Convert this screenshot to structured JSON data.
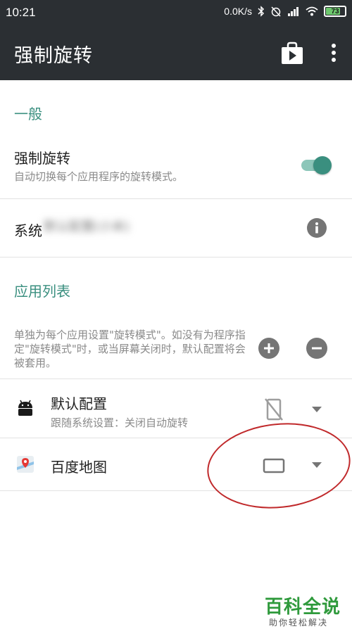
{
  "status_bar": {
    "time": "10:21",
    "network_speed": "0.0K/s",
    "battery": "73"
  },
  "app_bar": {
    "title": "强制旋转",
    "play_icon": "play-store-icon",
    "more_icon": "more-vert-icon"
  },
  "general": {
    "header": "一般",
    "force_rotate": {
      "title": "强制旋转",
      "subtitle": "自动切换每个应用程序的旋转模式。",
      "enabled": true
    },
    "system": {
      "title": "系统",
      "blurred_text": "默认配置(小米)",
      "info_icon": "info-icon"
    }
  },
  "app_list": {
    "header": "应用列表",
    "description": "单独为每个应用设置\"旋转模式\"。如没有为程序指定\"旋转模式\"时，或当屏幕关闭时，默认配置将会被套用。",
    "items": [
      {
        "name": "默认配置",
        "sub": "跟随系统设置：关闭自动旋转",
        "icon": "android-icon",
        "mode_icon": "screen-rotation-off-icon"
      },
      {
        "name": "百度地图",
        "sub": "",
        "icon": "baidu-maps-icon",
        "mode_icon": "landscape-icon"
      }
    ]
  },
  "watermark": {
    "main": "百科全说",
    "sub": "助你轻松解决"
  },
  "colors": {
    "accent": "#3a8f7f",
    "app_bar": "#2b2f33",
    "annotation": "#c0292b",
    "watermark": "#2f9a3c"
  }
}
